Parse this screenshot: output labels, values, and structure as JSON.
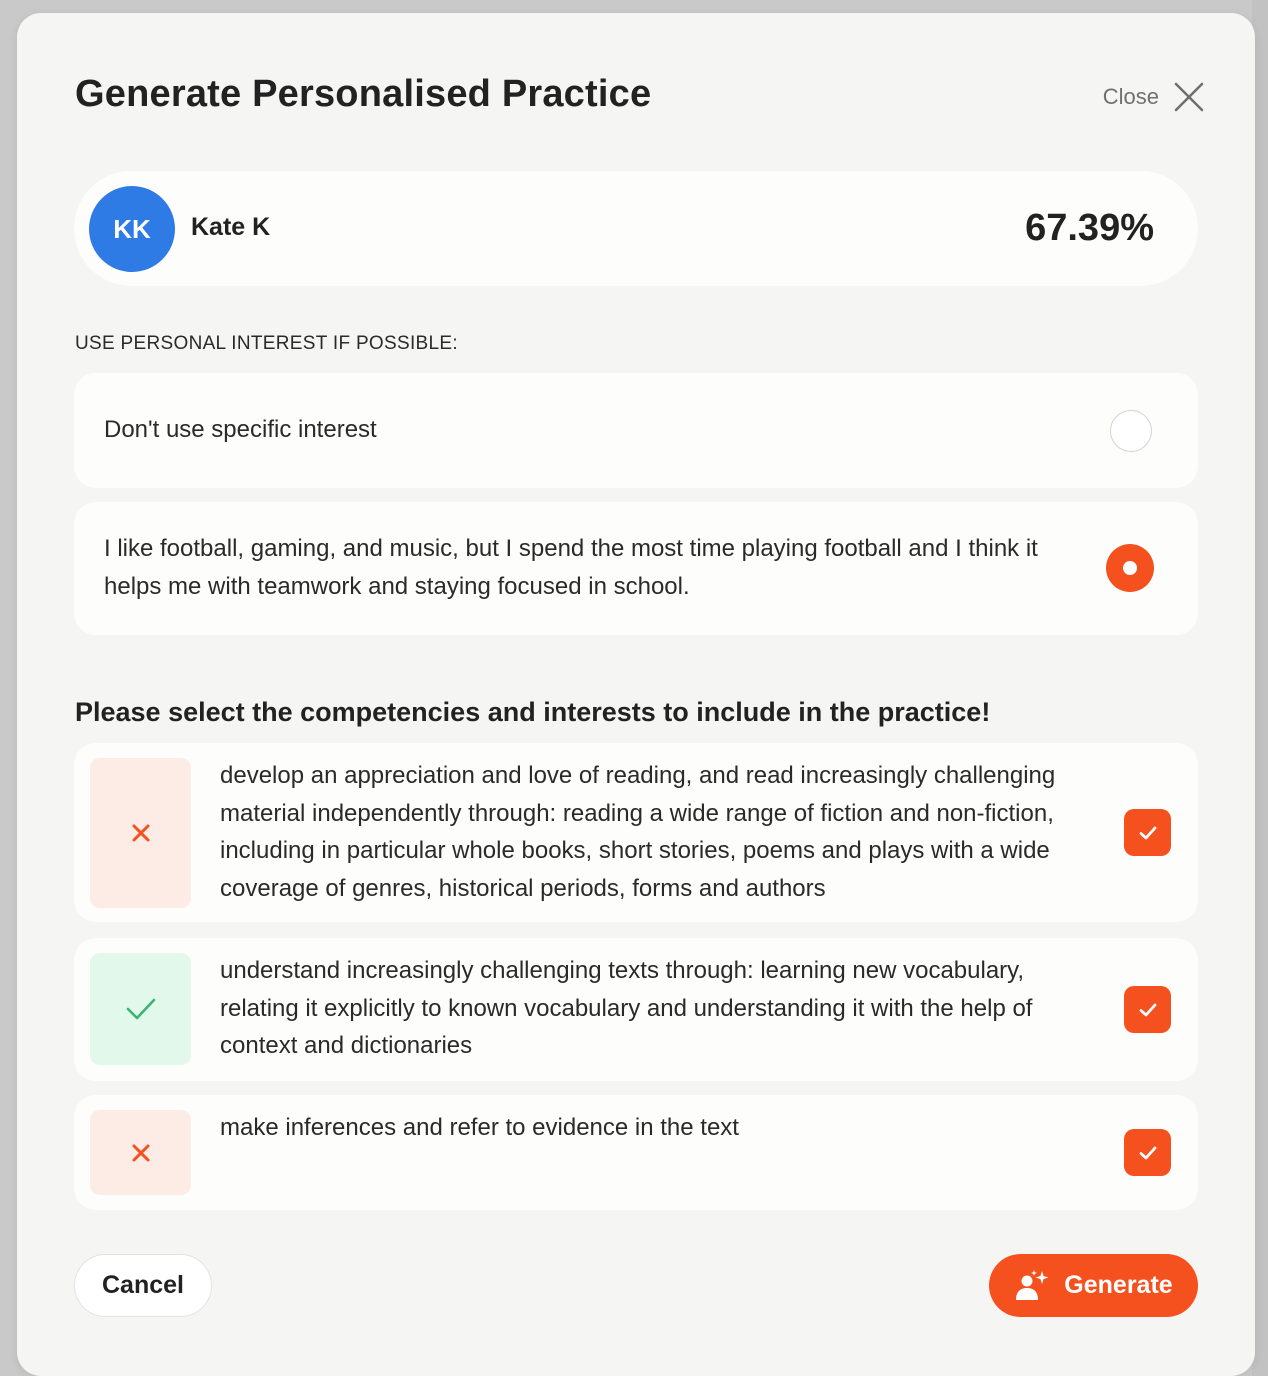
{
  "modal": {
    "title": "Generate Personalised Practice",
    "close_label": "Close"
  },
  "student": {
    "initials": "KK",
    "name": "Kate K",
    "score": "67.39%",
    "avatar_color": "#2f7be6"
  },
  "interest": {
    "section_label": "USE PERSONAL INTEREST IF POSSIBLE:",
    "options": [
      {
        "label": "Don't use specific interest",
        "selected": false
      },
      {
        "label": "I like football, gaming, and music, but I spend the most time playing football and I think it helps me with teamwork and staying focused in school.",
        "selected": true
      }
    ]
  },
  "competencies": {
    "prompt": "Please select the competencies and interests to include in the practice!",
    "items": [
      {
        "text": "develop an appreciation and love of reading, and read increasingly challenging material independently through: reading a wide range of fiction and non-fiction, including in particular whole books, short stories, poems and plays with a wide coverage of genres, historical periods, forms and authors",
        "status": "cross-icon",
        "checked": true
      },
      {
        "text": "understand increasingly challenging texts through: learning new vocabulary, relating it explicitly to known vocabulary and understanding it with the help of context and dictionaries",
        "status": "check-icon",
        "checked": true
      },
      {
        "text": "make inferences and refer to evidence in the text",
        "status": "cross-icon",
        "checked": true
      }
    ]
  },
  "actions": {
    "cancel_label": "Cancel",
    "generate_label": "Generate",
    "generate_icon": "sparkle-user-icon"
  },
  "colors": {
    "accent": "#f4511e",
    "bad_bg": "#fdece6",
    "good_bg": "#e1f8ea",
    "good_mark": "#3cb371"
  }
}
